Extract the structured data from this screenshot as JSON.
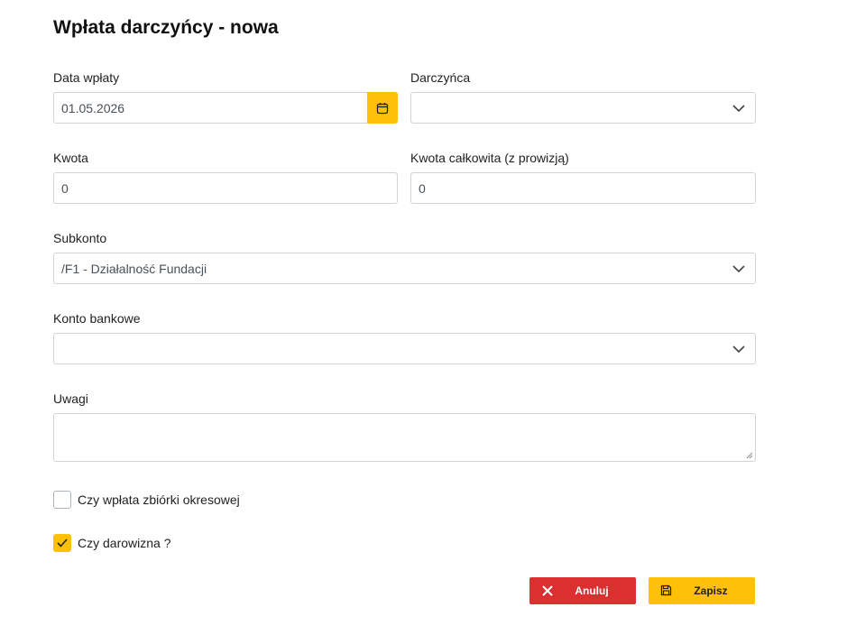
{
  "form": {
    "title": "Wpłata darczyńcy - nowa",
    "payment_date": {
      "label": "Data wpłaty",
      "value": "01.05.2026"
    },
    "donor": {
      "label": "Darczyńca",
      "value": ""
    },
    "amount": {
      "label": "Kwota",
      "value": "0"
    },
    "total_amount": {
      "label": "Kwota całkowita (z prowizją)",
      "value": "0"
    },
    "subaccount": {
      "label": "Subkonto",
      "value": "/F1 - Działalność Fundacji"
    },
    "bank_account": {
      "label": "Konto bankowe",
      "value": ""
    },
    "notes": {
      "label": "Uwagi",
      "value": ""
    },
    "periodic_collection": {
      "label": "Czy wpłata zbiórki okresowej",
      "checked": false
    },
    "is_donation": {
      "label": "Czy darowizna ?",
      "checked": true
    }
  },
  "actions": {
    "cancel_label": "Anuluj",
    "save_label": "Zapisz"
  },
  "colors": {
    "accent": "#ffc107",
    "danger": "#dc3030",
    "border": "#ced4da"
  },
  "icons": {
    "date_picker": "calendar-icon",
    "dropdown": "chevron-down-icon",
    "cancel": "close-icon",
    "save": "floppy-disk-icon",
    "check": "checkmark-icon"
  }
}
